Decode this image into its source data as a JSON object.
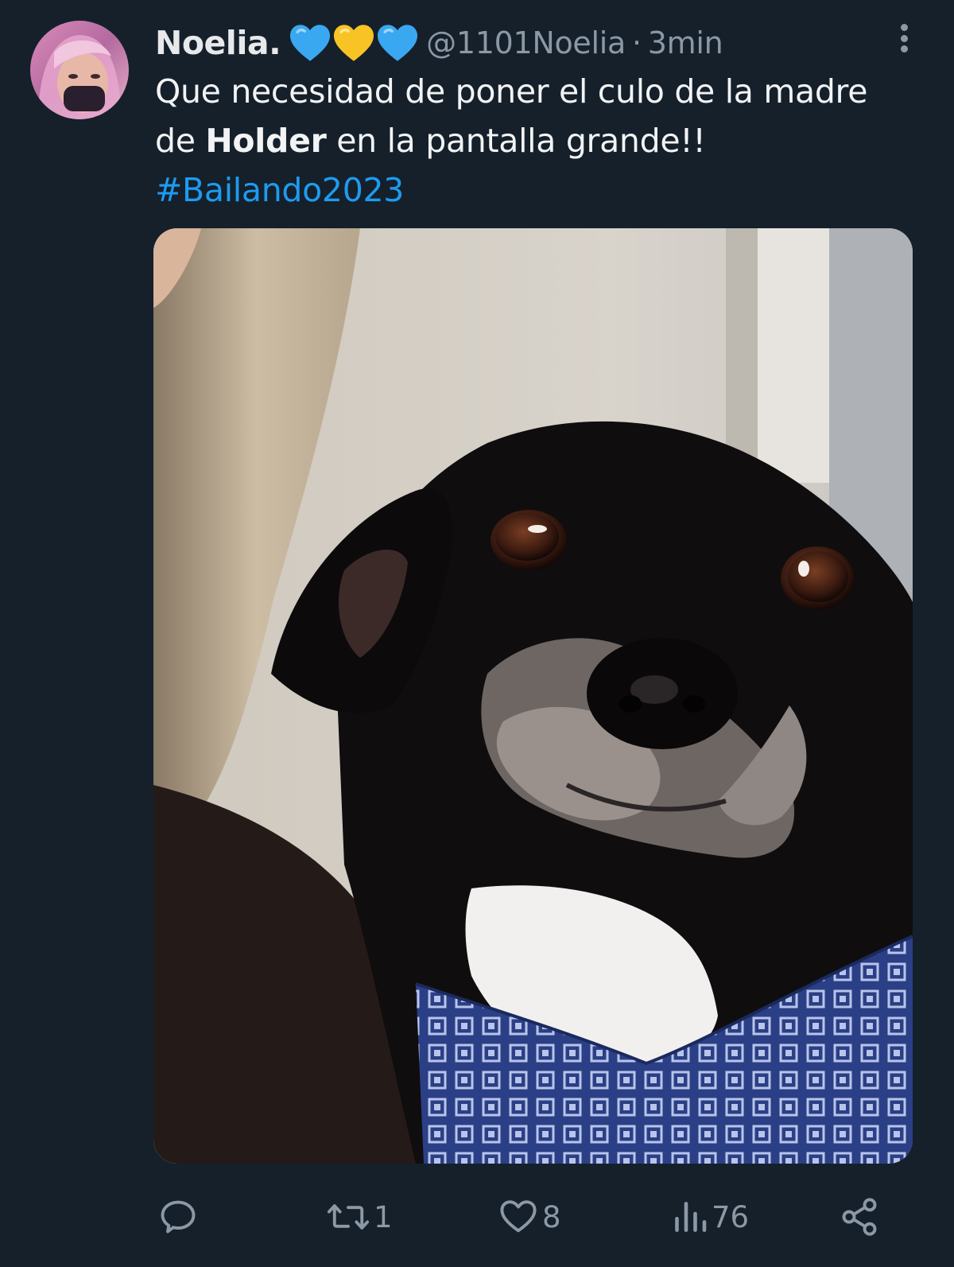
{
  "tweet": {
    "display_name": "Noelia.",
    "emoji_hearts": [
      "blue-heart",
      "yellow-heart",
      "blue-heart"
    ],
    "handle": "@1101Noelia",
    "separator": "·",
    "time": "3min",
    "text_part1": "Que necesidad de poner el culo de la madre de ",
    "text_bold": "Holder",
    "text_part2": " en la pantalla grande!!",
    "hashtag": "#Bailando2023"
  },
  "actions": {
    "reply_count": "",
    "retweet_count": "1",
    "like_count": "8",
    "views_count": "76"
  },
  "colors": {
    "background": "#15202b",
    "accent": "#1d9bf0",
    "muted": "#8b98a5",
    "heart_blue": "#3aa8f0",
    "heart_yellow": "#f7c325"
  },
  "icons": [
    "reply-icon",
    "retweet-icon",
    "like-icon",
    "views-icon",
    "share-icon",
    "more-icon"
  ]
}
